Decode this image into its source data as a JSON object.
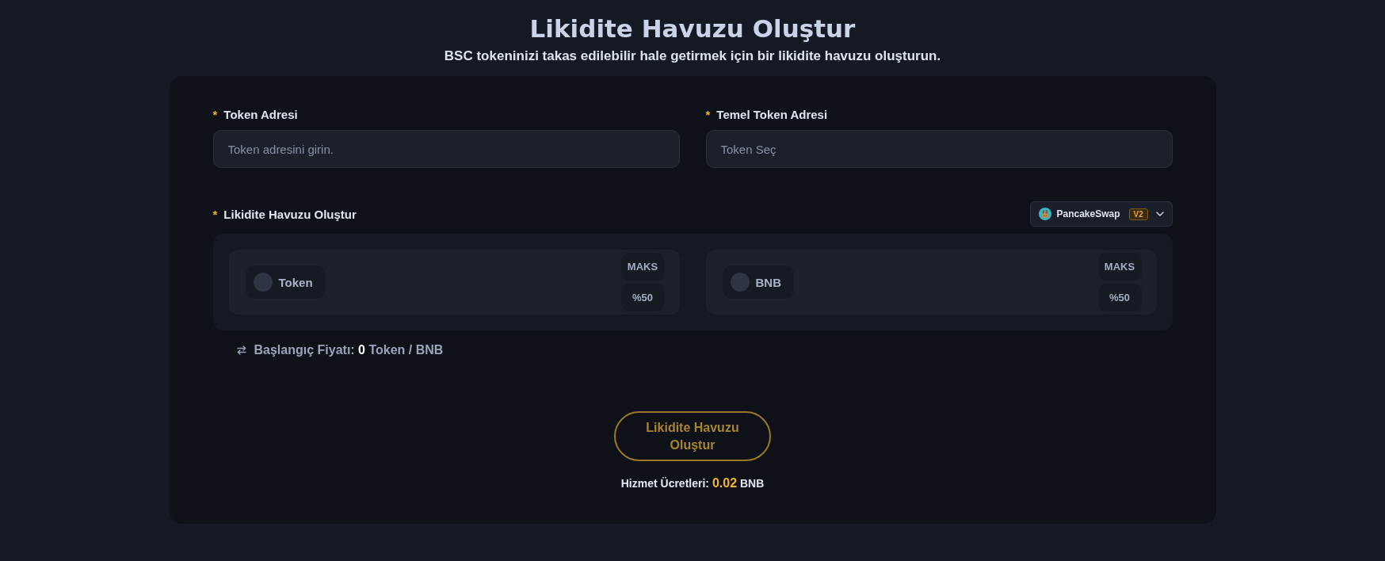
{
  "header": {
    "title": "Likidite Havuzu Oluştur",
    "subtitle": "BSC tokeninizi takas edilebilir hale getirmek için bir likidite havuzu oluşturun."
  },
  "fields": [
    {
      "required_mark": "*",
      "label": "Token Adresi",
      "placeholder": "Token adresini girin."
    },
    {
      "required_mark": "*",
      "label": "Temel Token Adresi",
      "placeholder": "Token Seç"
    }
  ],
  "pool": {
    "required_mark": "*",
    "label": "Likidite Havuzu Oluştur",
    "dex": {
      "name": "PancakeSwap",
      "version": "V2"
    },
    "assets": [
      {
        "symbol": "Token",
        "buttons": [
          "MAKS",
          "%50"
        ]
      },
      {
        "symbol": "BNB",
        "buttons": [
          "MAKS",
          "%50"
        ]
      }
    ]
  },
  "initial_price": "Başlangıç Fiyatı: **0** Token / BNB",
  "submit": {
    "label": "Likidite Havuzu Oluştur"
  },
  "fee": "Hizmet Ücretleri: **0.02** BNB"
}
